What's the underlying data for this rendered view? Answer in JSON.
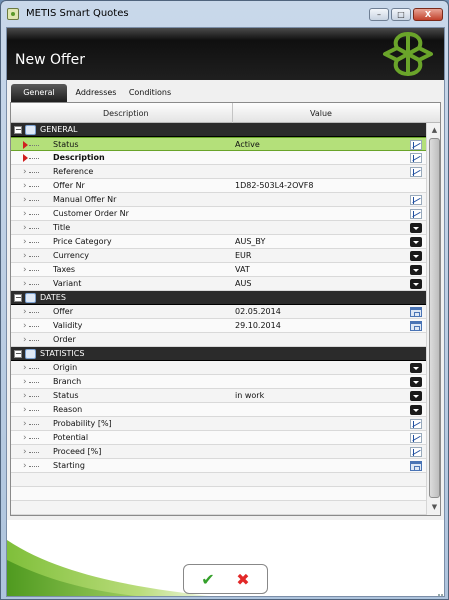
{
  "window": {
    "title": "METIS Smart Quotes",
    "minimize": "–",
    "maximize": "□",
    "close": "X"
  },
  "header": {
    "title": "New Offer"
  },
  "tabs": [
    "General",
    "Addresses",
    "Conditions"
  ],
  "columns": {
    "description": "Description",
    "value": "Value"
  },
  "rows": {
    "r0": {
      "label": "GENERAL",
      "value": ""
    },
    "r1": {
      "label": "Status",
      "value": "Active"
    },
    "r2": {
      "label": "Description",
      "value": ""
    },
    "r3": {
      "label": "Reference",
      "value": ""
    },
    "r4": {
      "label": "Offer Nr",
      "value": "1D82-503L4-2OVF8"
    },
    "r5": {
      "label": "Manual Offer Nr",
      "value": ""
    },
    "r6": {
      "label": "Customer Order Nr",
      "value": ""
    },
    "r7": {
      "label": "Title",
      "value": ""
    },
    "r8": {
      "label": "Price Category",
      "value": "AUS_BY"
    },
    "r9": {
      "label": "Currency",
      "value": "EUR"
    },
    "r10": {
      "label": "Taxes",
      "value": "VAT"
    },
    "r11": {
      "label": "Variant",
      "value": "AUS"
    },
    "r12": {
      "label": "DATES",
      "value": ""
    },
    "r13": {
      "label": "Offer",
      "value": "02.05.2014"
    },
    "r14": {
      "label": "Validity",
      "value": "29.10.2014"
    },
    "r15": {
      "label": "Order",
      "value": ""
    },
    "r16": {
      "label": "STATISTICS",
      "value": ""
    },
    "r17": {
      "label": "Origin",
      "value": ""
    },
    "r18": {
      "label": "Branch",
      "value": ""
    },
    "r19": {
      "label": "Status",
      "value": "in work"
    },
    "r20": {
      "label": "Reason",
      "value": ""
    },
    "r21": {
      "label": "Probability [%]",
      "value": ""
    },
    "r22": {
      "label": "Potential",
      "value": ""
    },
    "r23": {
      "label": "Proceed [%]",
      "value": ""
    },
    "r24": {
      "label": "Starting",
      "value": ""
    }
  },
  "buttons": {
    "ok": "✔",
    "cancel": "✖"
  },
  "colors": {
    "selected_row": "#b4e07a",
    "section_row": "#2b2b2b",
    "ok": "#34a02a",
    "cancel": "#e22828",
    "logo": "#6aa42a"
  }
}
